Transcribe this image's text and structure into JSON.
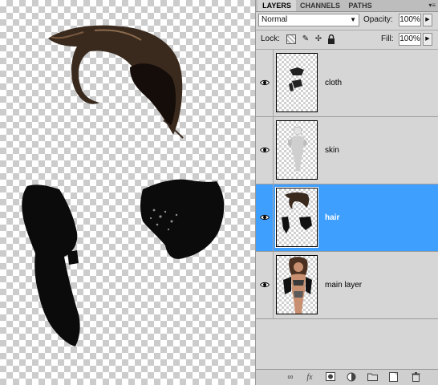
{
  "tabs": [
    "LAYERS",
    "CHANNELS",
    "PATHS"
  ],
  "panel_menu_icon": "panel-menu-icon",
  "blend_mode": "Normal",
  "opacity_label": "Opacity:",
  "opacity_value": "100%",
  "lock_label": "Lock:",
  "fill_label": "Fill:",
  "fill_value": "100%",
  "layers": [
    {
      "name": "cloth",
      "visible": true,
      "selected": false
    },
    {
      "name": "skin",
      "visible": true,
      "selected": false
    },
    {
      "name": "hair",
      "visible": true,
      "selected": true
    },
    {
      "name": "main layer",
      "visible": true,
      "selected": false
    }
  ],
  "colors": {
    "selection": "#3f9fff",
    "panel": "#d6d6d6",
    "hair": "#3a2a1e"
  },
  "footer_icons": [
    "link-icon",
    "fx-icon",
    "mask-icon",
    "adjustment-icon",
    "group-icon",
    "new-layer-icon",
    "trash-icon"
  ]
}
